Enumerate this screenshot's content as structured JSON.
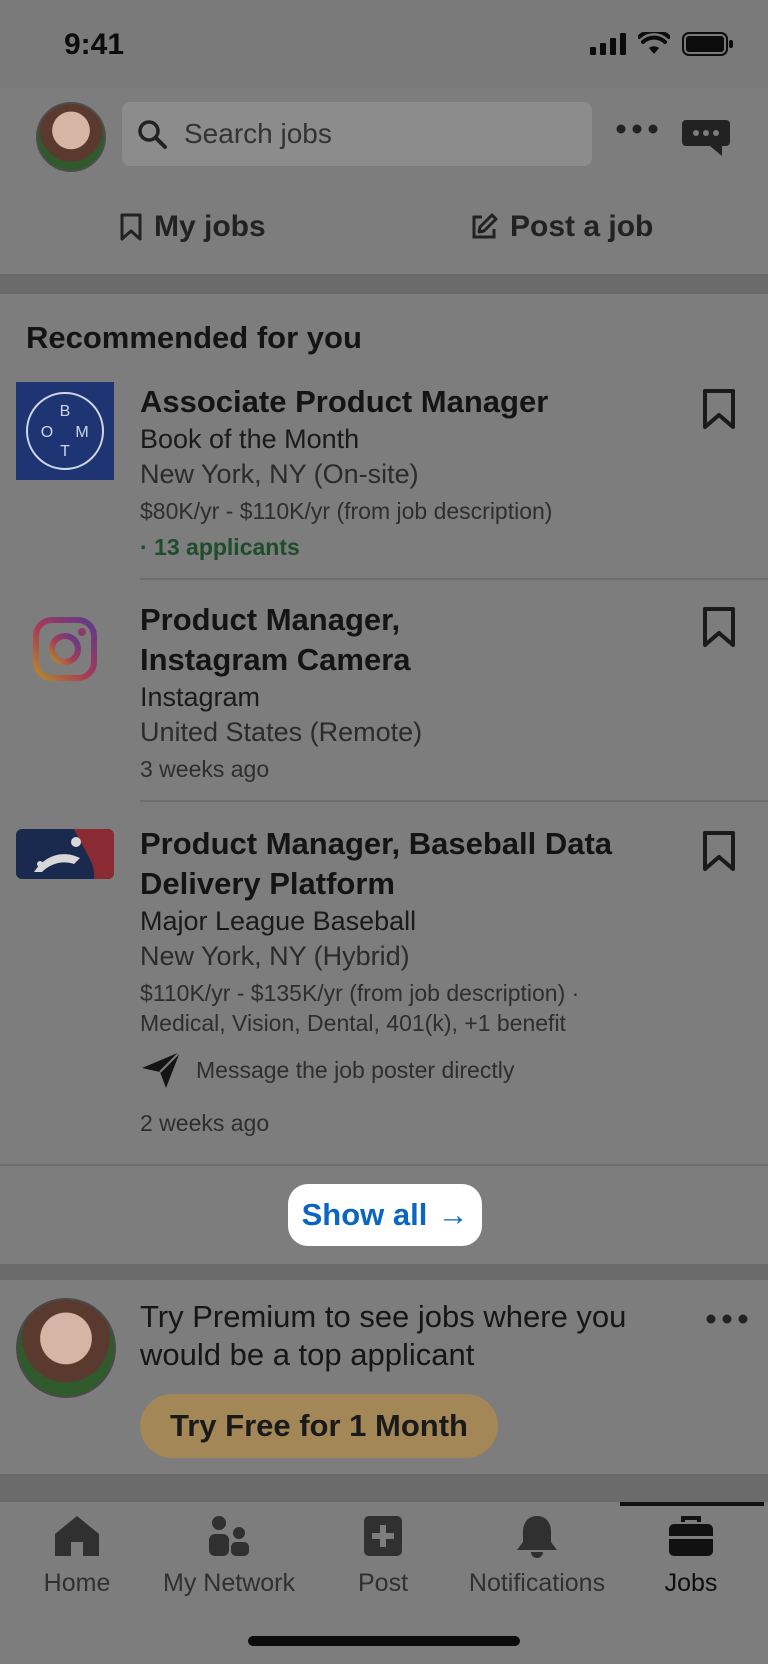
{
  "status": {
    "time": "9:41"
  },
  "header": {
    "search_placeholder": "Search jobs",
    "my_jobs": "My jobs",
    "post_job": "Post a job"
  },
  "recommended": {
    "title": "Recommended for you",
    "jobs": [
      {
        "title": "Associate Product Manager",
        "company": "Book of the Month",
        "location": "New York, NY (On-site)",
        "salary": "$80K/yr - $110K/yr (from job description)",
        "applicants": "· 13 applicants"
      },
      {
        "title_line1": "Product Manager,",
        "title_line2": "Instagram Camera",
        "company": "Instagram",
        "location": "United States (Remote)",
        "posted": "3 weeks ago"
      },
      {
        "title_line1": "Product Manager, Baseball Data",
        "title_line2": "Delivery Platform",
        "company": "Major League Baseball",
        "location": "New York, NY (Hybrid)",
        "salary": "$110K/yr - $135K/yr (from job description) ·",
        "benefits": "Medical, Vision, Dental, 401(k), +1 benefit",
        "message": "Message the job poster directly",
        "posted": "2 weeks ago"
      }
    ],
    "show_all": "Show all",
    "show_all_arrow": "→",
    "bom_logo_letters": [
      "B",
      "O",
      "M",
      "T"
    ]
  },
  "premium": {
    "text": "Try Premium to see jobs where you would be a top applicant",
    "button": "Try Free for 1 Month"
  },
  "tabs": [
    {
      "label": "Home",
      "icon": "home-icon"
    },
    {
      "label": "My Network",
      "icon": "network-icon"
    },
    {
      "label": "Post",
      "icon": "plus-square-icon"
    },
    {
      "label": "Notifications",
      "icon": "bell-icon"
    },
    {
      "label": "Jobs",
      "icon": "briefcase-icon",
      "active": true
    }
  ],
  "colors": {
    "link_blue": "#0a66c2",
    "applicants_green": "#1d4d2b",
    "premium_gold": "#a48756"
  }
}
